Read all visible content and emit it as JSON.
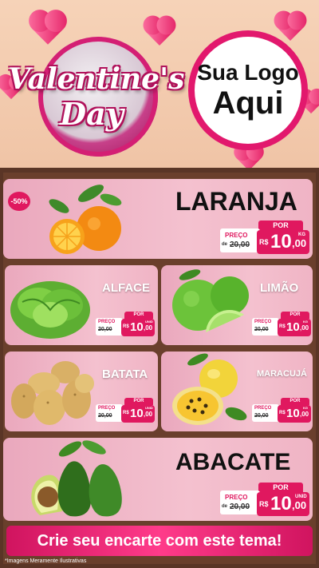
{
  "header": {
    "title_line1": "Valentine's",
    "title_line2": "Day",
    "logo_line1": "Sua Logo",
    "logo_line2": "Aqui"
  },
  "colors": {
    "accent": "#e0185f",
    "card_pink": "#f4c1cf",
    "wood": "#6a3f2c"
  },
  "products": [
    {
      "id": "laranja",
      "name": "LARANJA",
      "discount": "-50%",
      "por": "POR",
      "preco": "PREÇO",
      "de": "de",
      "old": "20,00",
      "currency": "R$",
      "price_int": "10",
      "price_dec": ",00",
      "unit": "KG",
      "image": "orange-icon"
    },
    {
      "id": "alface",
      "name": "ALFACE",
      "por": "POR",
      "preco": "PREÇO",
      "de": "de",
      "old": "20,00",
      "currency": "R$",
      "price_int": "10",
      "price_dec": ",00",
      "unit": "UNID",
      "image": "lettuce-icon"
    },
    {
      "id": "limao",
      "name": "LIMÃO",
      "por": "POR",
      "preco": "PREÇO",
      "de": "de",
      "old": "20,00",
      "currency": "R$",
      "price_int": "10",
      "price_dec": ",00",
      "unit": "KG",
      "image": "lime-icon"
    },
    {
      "id": "batata",
      "name": "BATATA",
      "por": "POR",
      "preco": "PREÇO",
      "de": "de",
      "old": "20,00",
      "currency": "R$",
      "price_int": "10",
      "price_dec": ",00",
      "unit": "UNID",
      "image": "potato-icon"
    },
    {
      "id": "maracuja",
      "name": "MARACUJÁ",
      "por": "POR",
      "preco": "PREÇO",
      "de": "de",
      "old": "20,00",
      "currency": "R$",
      "price_int": "10",
      "price_dec": ",00",
      "unit": "KG",
      "image": "passion-fruit-icon"
    },
    {
      "id": "abacate",
      "name": "ABACATE",
      "por": "POR",
      "preco": "PREÇO",
      "de": "de",
      "old": "20,00",
      "currency": "R$",
      "price_int": "10",
      "price_dec": ",00",
      "unit": "UNID",
      "image": "avocado-icon"
    }
  ],
  "banner": {
    "text": "Crie seu encarte com este tema!"
  },
  "footnote": "*Imagens Meramente Ilustrativas"
}
